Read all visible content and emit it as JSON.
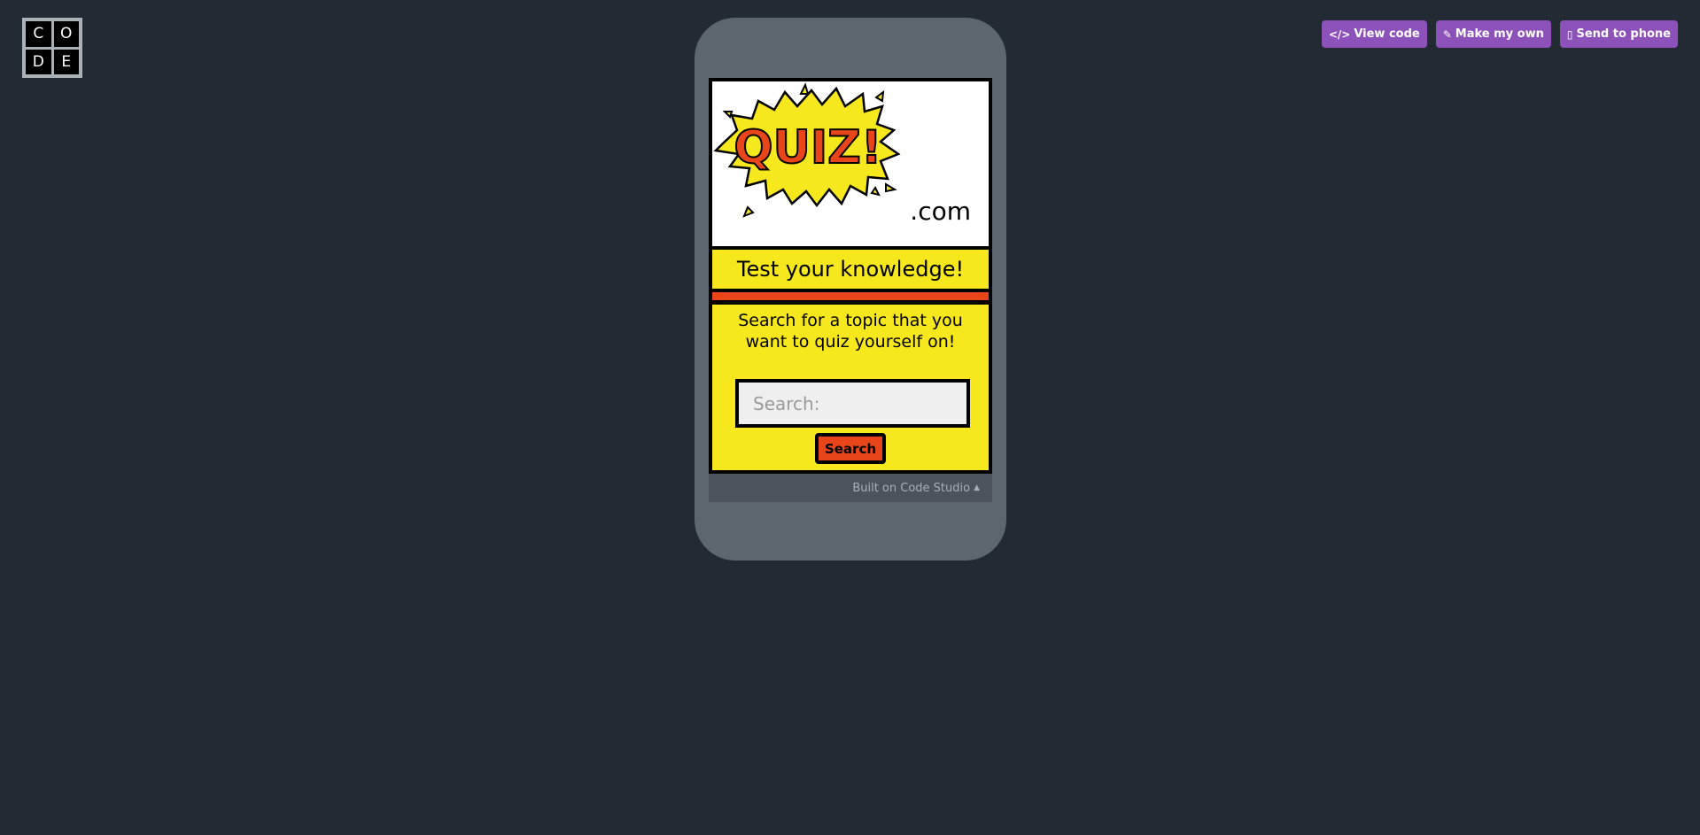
{
  "logo": {
    "letters": [
      "C",
      "O",
      "D",
      "E"
    ]
  },
  "actions": [
    {
      "label": "View code",
      "icon": "code-icon"
    },
    {
      "label": "Make my own",
      "icon": "edit-icon"
    },
    {
      "label": "Send to phone",
      "icon": "phone-icon"
    }
  ],
  "app": {
    "banner": {
      "quiz_text": "QUIZ!",
      "domain": ".com"
    },
    "tagline": "Test your knowledge!",
    "prompt": "Search for a topic that you want to quiz yourself on!",
    "search": {
      "placeholder": "Search:",
      "button_label": "Search"
    }
  },
  "footer": {
    "label": "Built on Code Studio",
    "caret": "▲"
  },
  "colors": {
    "background": "#222a33",
    "accent": "#8c52ba",
    "yellow": "#f7e81d",
    "red": "#e8461a",
    "phone": "#5b666d"
  }
}
